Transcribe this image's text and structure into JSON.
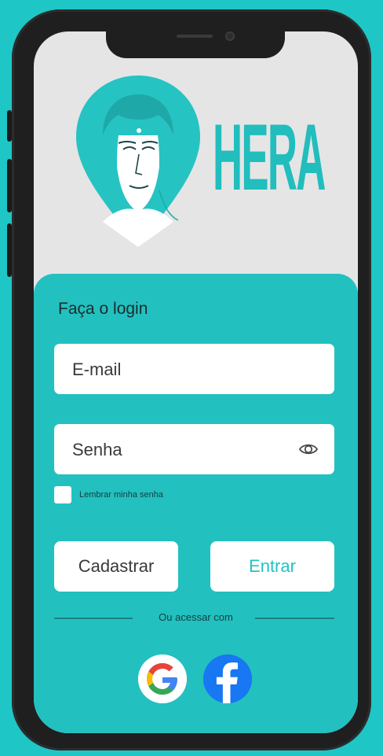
{
  "app": {
    "brand_name": "HERA",
    "colors": {
      "background": "#1ec6c6",
      "accent": "#23c0c0",
      "phone_frame": "#1f1f1f",
      "field": "#ffffff",
      "facebook": "#1877f2"
    }
  },
  "login": {
    "title": "Faça o login",
    "email_placeholder": "E-mail",
    "password_placeholder": "Senha",
    "password_toggle_icon": "eye-icon",
    "remember_label": "Lembrar minha senha",
    "register_button": "Cadastrar",
    "login_button": "Entrar",
    "divider_text": "Ou acessar com"
  },
  "social": [
    {
      "name": "google",
      "icon": "google-icon"
    },
    {
      "name": "facebook",
      "icon": "facebook-icon"
    }
  ]
}
